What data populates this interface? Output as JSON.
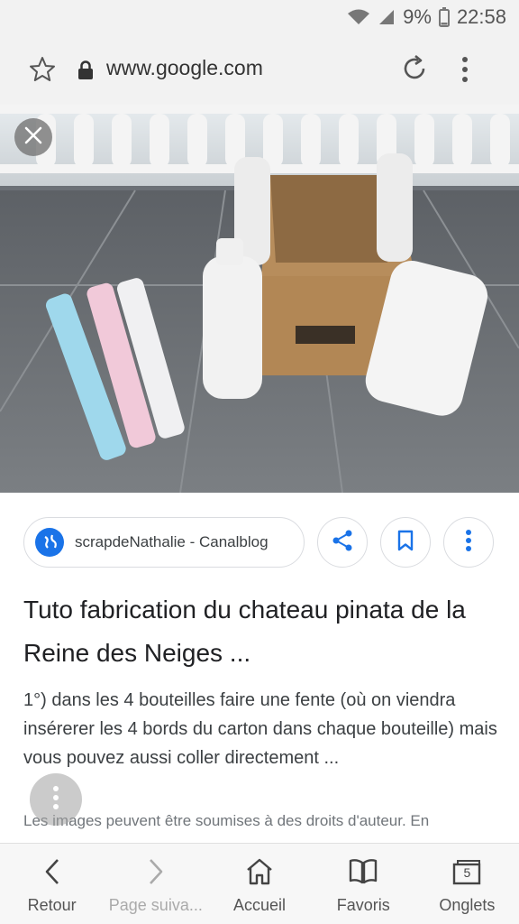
{
  "status_bar": {
    "battery": "9%",
    "time": "22:58"
  },
  "url_bar": {
    "url": "www.google.com"
  },
  "result": {
    "source": "scrapdeNathalie - Canalblog",
    "title": "Tuto fabrication du chateau pinata de la Reine des Neiges ...",
    "snippet": "1°) dans les 4 bouteilles faire une fente (où on viendra insérerer les 4 bords du carton dans chaque bouteille) mais vous pouvez aussi coller directement ...",
    "copyright": "Les images peuvent être soumises à des droits d'auteur. En"
  },
  "bottom_nav": {
    "items": [
      {
        "label": "Retour",
        "icon": "chevron-left-icon"
      },
      {
        "label": "Page suiva...",
        "icon": "chevron-right-icon"
      },
      {
        "label": "Accueil",
        "icon": "home-icon"
      },
      {
        "label": "Favoris",
        "icon": "bookmarks-icon"
      },
      {
        "label": "Onglets",
        "icon": "tabs-icon",
        "badge": "5"
      }
    ]
  },
  "colors": {
    "accent": "#1a73e8",
    "chrome_bg": "#f2f2f2"
  }
}
